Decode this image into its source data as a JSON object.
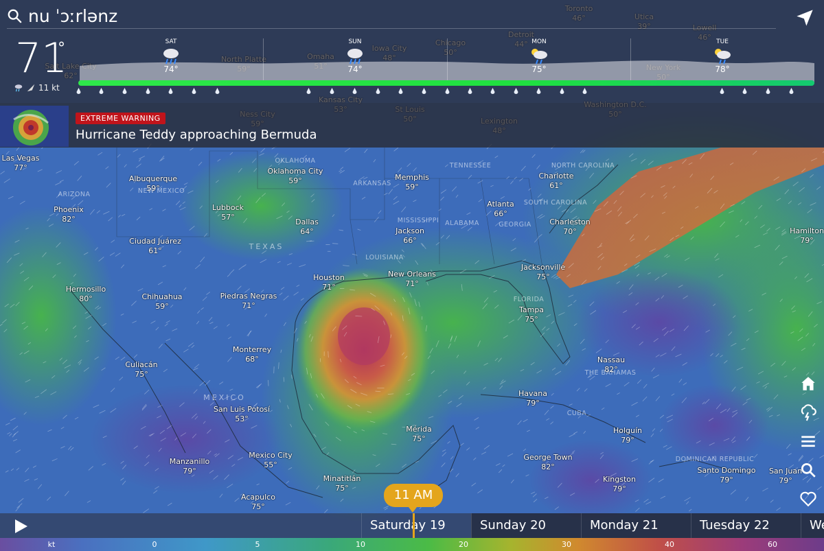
{
  "search": {
    "text": "nu ˈɔːrlənz"
  },
  "current": {
    "temp": "71",
    "deg": "°",
    "wind": "11 kt"
  },
  "forecast": [
    {
      "day": "SAT",
      "temp": "74°",
      "icon": "rain-icon"
    },
    {
      "day": "SUN",
      "temp": "74°",
      "icon": "rain-icon"
    },
    {
      "day": "MON",
      "temp": "75°",
      "icon": "sun-rain-icon"
    },
    {
      "day": "TUE",
      "temp": "78°",
      "icon": "sun-rain-icon"
    }
  ],
  "alert": {
    "badge": "EXTREME WARNING",
    "title": "Hurricane Teddy approaching Bermuda"
  },
  "cities": [
    {
      "name": "Las Vegas",
      "temp": "77°"
    },
    {
      "name": "Albuquerque",
      "temp": "59°"
    },
    {
      "name": "Phoenix",
      "temp": "82°"
    },
    {
      "name": "Oklahoma City",
      "temp": "59°"
    },
    {
      "name": "Memphis",
      "temp": "59°"
    },
    {
      "name": "Charlotte",
      "temp": "61°"
    },
    {
      "name": "Lubbock",
      "temp": "57°"
    },
    {
      "name": "Atlanta",
      "temp": "66°"
    },
    {
      "name": "Dallas",
      "temp": "64°"
    },
    {
      "name": "Charleston",
      "temp": "70°"
    },
    {
      "name": "Jackson",
      "temp": "66°"
    },
    {
      "name": "Ciudad Juárez",
      "temp": "61°"
    },
    {
      "name": "Hamilton",
      "temp": "79°"
    },
    {
      "name": "Jacksonville",
      "temp": "75°"
    },
    {
      "name": "Houston",
      "temp": "71°"
    },
    {
      "name": "New Orleans",
      "temp": "71°"
    },
    {
      "name": "Hermosillo",
      "temp": "80°"
    },
    {
      "name": "Chihuahua",
      "temp": "59°"
    },
    {
      "name": "Piedras Negras",
      "temp": "71°"
    },
    {
      "name": "Tampa",
      "temp": "75°"
    },
    {
      "name": "Monterrey",
      "temp": "68°"
    },
    {
      "name": "Nassau",
      "temp": "82°"
    },
    {
      "name": "Culiacán",
      "temp": "75°"
    },
    {
      "name": "Havana",
      "temp": "79°"
    },
    {
      "name": "San Luis Potosí",
      "temp": "53°"
    },
    {
      "name": "Mérida",
      "temp": "75°"
    },
    {
      "name": "Holguín",
      "temp": "79°"
    },
    {
      "name": "Mexico City",
      "temp": "55°"
    },
    {
      "name": "George Town",
      "temp": "82°"
    },
    {
      "name": "Manzanillo",
      "temp": "79°"
    },
    {
      "name": "Santo Domingo",
      "temp": "79°"
    },
    {
      "name": "San Juan",
      "temp": "79°"
    },
    {
      "name": "Minatitlán",
      "temp": "75°"
    },
    {
      "name": "Kingston",
      "temp": "79°"
    },
    {
      "name": "Acapulco",
      "temp": "75°"
    },
    {
      "name": "Salt Lake City",
      "temp": "62°"
    },
    {
      "name": "North Platte",
      "temp": "59°"
    },
    {
      "name": "Omaha",
      "temp": "51°"
    },
    {
      "name": "Iowa City",
      "temp": "48°"
    },
    {
      "name": "Chicago",
      "temp": "50°"
    },
    {
      "name": "Detroit",
      "temp": "44°"
    },
    {
      "name": "Toronto",
      "temp": "46°"
    },
    {
      "name": "Utica",
      "temp": "39°"
    },
    {
      "name": "Lowell",
      "temp": "46°"
    },
    {
      "name": "New York",
      "temp": "50°"
    },
    {
      "name": "Kansas City",
      "temp": "53°"
    },
    {
      "name": "St Louis",
      "temp": "50°"
    },
    {
      "name": "Lexington",
      "temp": "48°"
    },
    {
      "name": "Washington D.C.",
      "temp": "50°"
    },
    {
      "name": "Ness City",
      "temp": "59°"
    }
  ],
  "regions": [
    "ARIZONA",
    "NEW MEXICO",
    "OKLAHOMA",
    "ARKANSAS",
    "TENNESSEE",
    "NORTH CAROLINA",
    "SOUTH CAROLINA",
    "MISSISSIPPI",
    "ALABAMA",
    "GEORGIA",
    "LOUISIANA",
    "TEXAS",
    "FLORIDA",
    "THE BAHAMAS",
    "CUBA",
    "MEXICO",
    "DOMINICAN REPUBLIC"
  ],
  "time_bubble": "11 AM",
  "days": [
    "Saturday 19",
    "Sunday 20",
    "Monday 21",
    "Tuesday 22",
    "We"
  ],
  "legend": {
    "unit": "kt",
    "ticks": [
      "0",
      "5",
      "10",
      "20",
      "30",
      "40",
      "60"
    ]
  },
  "colors": {
    "warning": "#c0141b",
    "accent": "#e4a51c",
    "rain_bar": "#2ee84a"
  }
}
